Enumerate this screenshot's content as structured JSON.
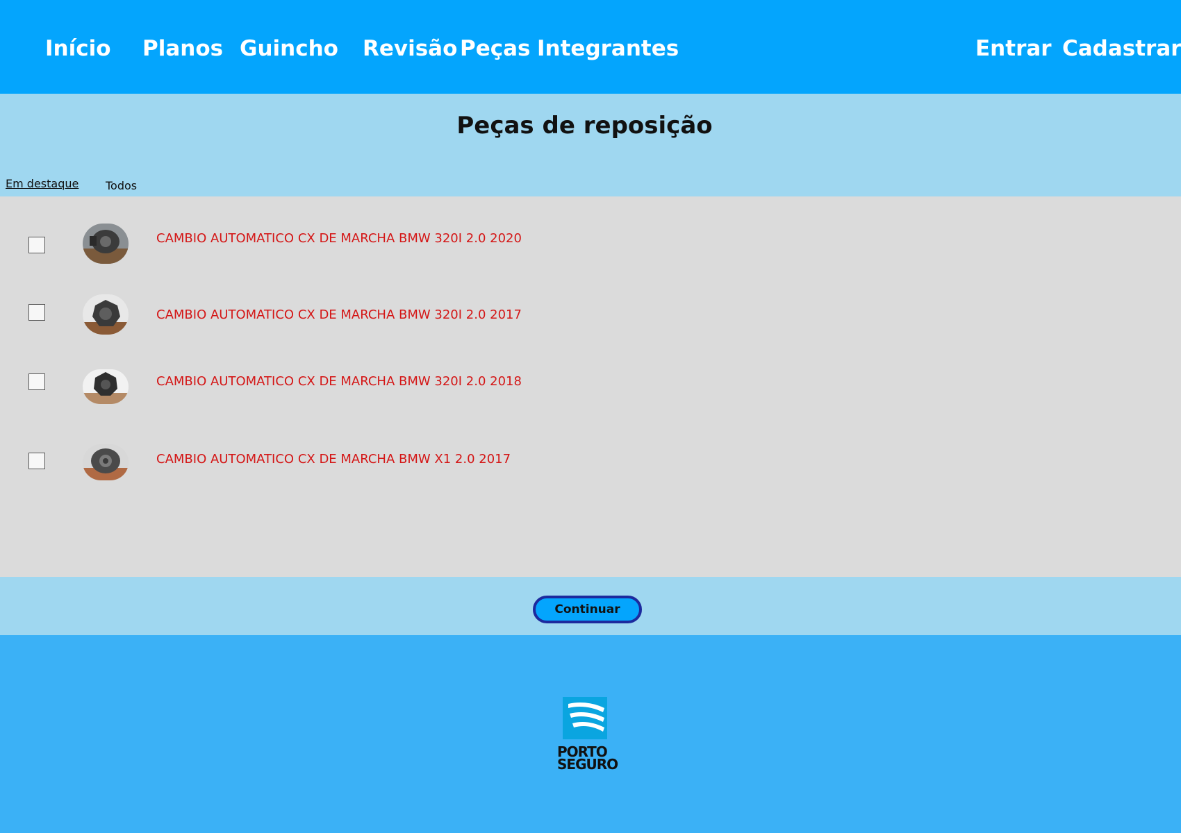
{
  "nav": {
    "links": [
      "Início",
      "Planos",
      "Guincho",
      "Revisão",
      "Peças",
      "Integrantes"
    ],
    "entrar": "Entrar",
    "cadastrar": "Cadastrar"
  },
  "page": {
    "title": "Peças de reposição"
  },
  "filters": {
    "featured": "Em destaque",
    "all": "Todos"
  },
  "parts": [
    {
      "name": "CAMBIO AUTOMATICO CX DE MARCHA BMW 320I 2.0 2020",
      "checked": false
    },
    {
      "name": "CAMBIO AUTOMATICO CX DE MARCHA BMW 320I 2.0 2017",
      "checked": false
    },
    {
      "name": "CAMBIO AUTOMATICO CX DE MARCHA BMW 320I 2.0 2018",
      "checked": false
    },
    {
      "name": "CAMBIO AUTOMATICO CX DE MARCHA BMW X1 2.0 2017",
      "checked": false
    }
  ],
  "actions": {
    "continue": "Continuar"
  },
  "footer": {
    "logo_line1": "PORTO",
    "logo_line2": "SEGURO"
  },
  "colors": {
    "header": "#04a5fd",
    "band": "#9fd7f0",
    "list_bg": "#dbdbdb",
    "footer": "#3bb1f6",
    "part_name": "#d41616",
    "button_border": "#1c2a9e"
  }
}
